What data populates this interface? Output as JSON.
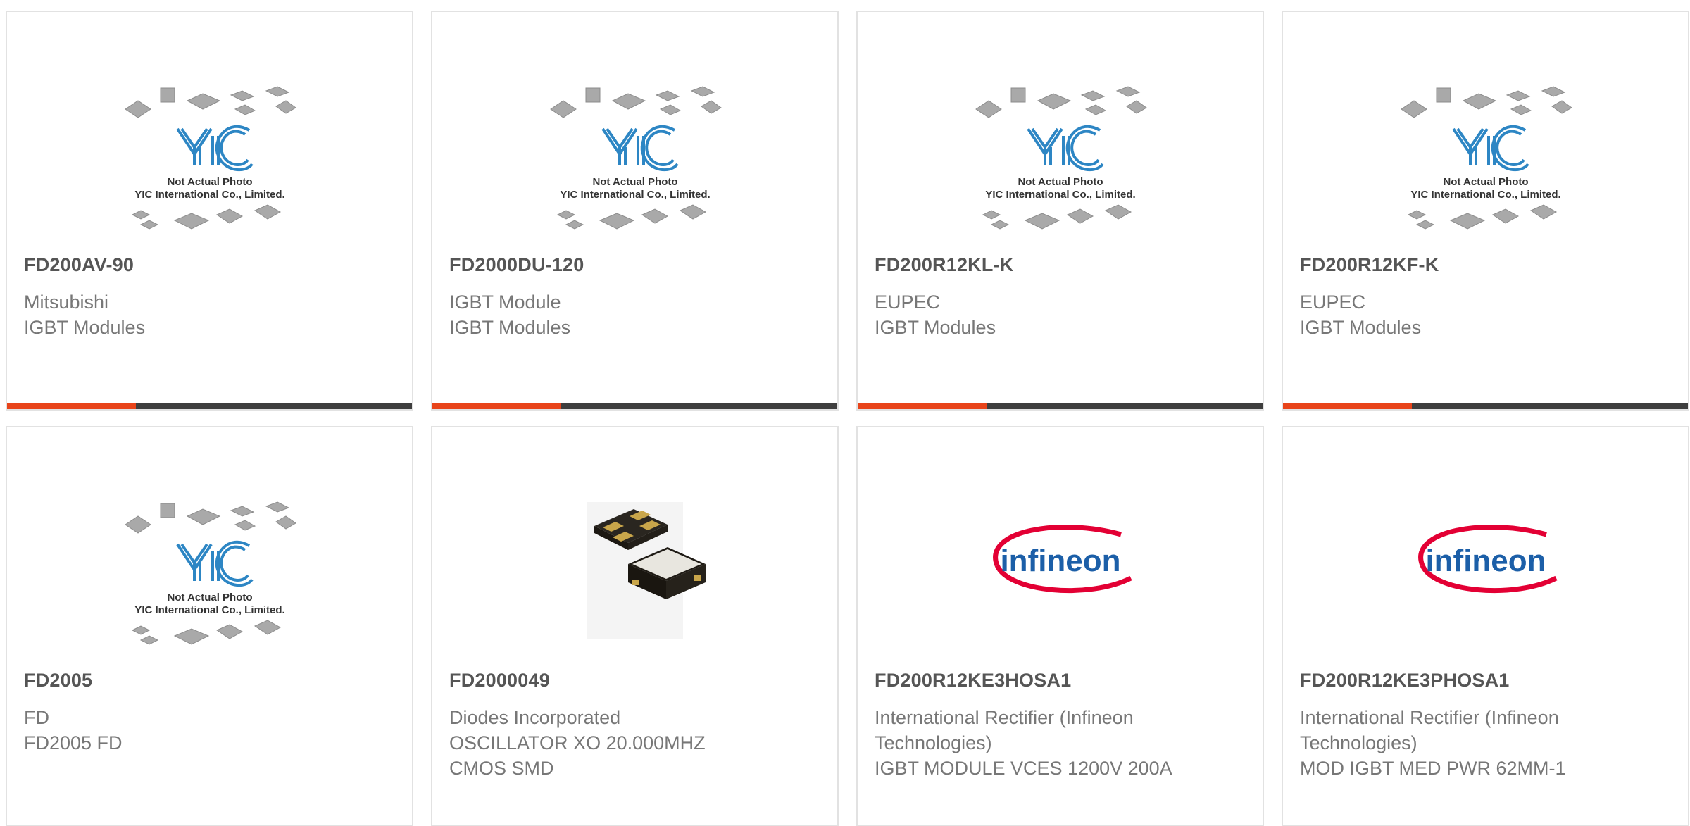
{
  "products": [
    {
      "part_number": "FD200AV-90",
      "brand": "Mitsubishi",
      "description": "IGBT Modules",
      "image": "yic-placeholder",
      "photo_text_1": "Not Actual Photo",
      "photo_text_2": "YIC International Co., Limited."
    },
    {
      "part_number": "FD2000DU-120",
      "brand": "IGBT Module",
      "description": "IGBT Modules",
      "image": "yic-placeholder",
      "photo_text_1": "Not Actual Photo",
      "photo_text_2": "YIC International Co., Limited."
    },
    {
      "part_number": "FD200R12KL-K",
      "brand": "EUPEC",
      "description": "IGBT Modules",
      "image": "yic-placeholder",
      "photo_text_1": "Not Actual Photo",
      "photo_text_2": "YIC International Co., Limited."
    },
    {
      "part_number": "FD200R12KF-K",
      "brand": "EUPEC",
      "description": "IGBT Modules",
      "image": "yic-placeholder",
      "photo_text_1": "Not Actual Photo",
      "photo_text_2": "YIC International Co., Limited."
    },
    {
      "part_number": "FD2005",
      "brand": "FD",
      "description": "FD2005 FD",
      "image": "yic-placeholder",
      "photo_text_1": "Not Actual Photo",
      "photo_text_2": "YIC International Co., Limited."
    },
    {
      "part_number": "FD2000049",
      "brand": "Diodes Incorporated",
      "description": "OSCILLATOR XO 20.000MHZ CMOS SMD",
      "image": "oscillator-photo"
    },
    {
      "part_number": "FD200R12KE3HOSA1",
      "brand": "International Rectifier (Infineon Technologies)",
      "description": "IGBT MODULE VCES 1200V 200A",
      "image": "infineon-logo",
      "logo_text": "infineon"
    },
    {
      "part_number": "FD200R12KE3PHOSA1",
      "brand": "International Rectifier (Infineon Technologies)",
      "description": "MOD IGBT MED PWR 62MM-1",
      "image": "infineon-logo",
      "logo_text": "infineon"
    }
  ],
  "colors": {
    "accent": "#e8441a",
    "bar": "#3e3e3e",
    "yic_blue": "#2d86c4",
    "infineon_red": "#e30034",
    "infineon_blue": "#1c5fa8"
  }
}
